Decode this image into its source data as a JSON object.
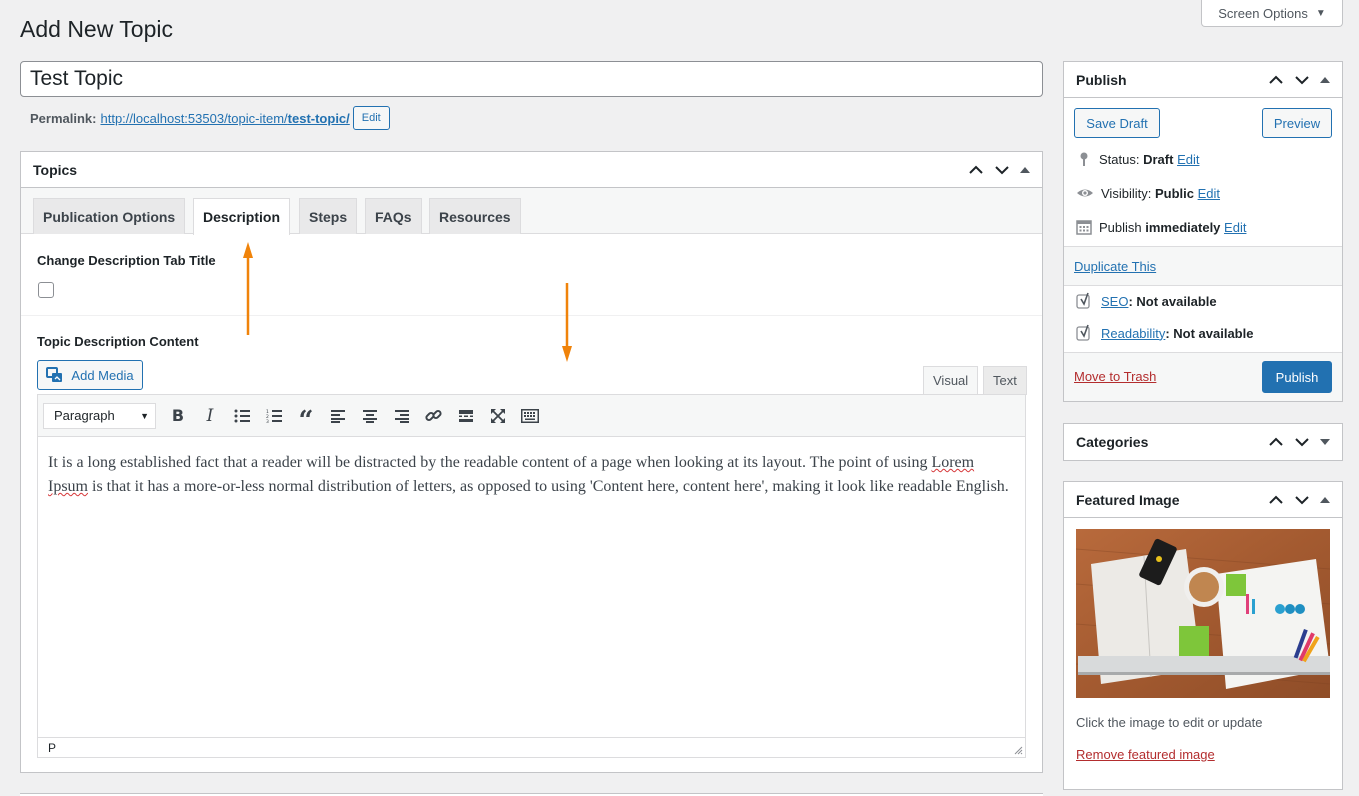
{
  "screen_options": {
    "label": "Screen Options"
  },
  "page": {
    "title": "Add New Topic"
  },
  "post_title": {
    "value": "Test Topic"
  },
  "permalink": {
    "label": "Permalink:",
    "url_base": "http://localhost:53503/topic-item/",
    "slug": "test-topic/",
    "edit_label": "Edit"
  },
  "topics_box": {
    "title": "Topics",
    "tabs": [
      {
        "label": "Publication Options",
        "active": false
      },
      {
        "label": "Description",
        "active": true
      },
      {
        "label": "Steps",
        "active": false
      },
      {
        "label": "FAQs",
        "active": false
      },
      {
        "label": "Resources",
        "active": false
      }
    ],
    "change_tab_title_label": "Change Description Tab Title",
    "description_label": "Topic Description Content",
    "add_media_label": "Add Media",
    "editor_modes": {
      "visual": "Visual",
      "text": "Text",
      "active": "visual"
    },
    "format_select": "Paragraph",
    "toolbar_icons": [
      "bold-icon",
      "italic-icon",
      "bulleted-list-icon",
      "numbered-list-icon",
      "blockquote-icon",
      "align-left-icon",
      "align-center-icon",
      "align-right-icon",
      "link-icon",
      "read-more-icon",
      "fullscreen-icon",
      "toolbar-toggle-icon"
    ],
    "content": {
      "part1": "It is a long established fact that a reader will be distracted by the readable content of a page when looking at its layout. The point of using ",
      "spell_word": "Lorem Ipsum",
      "part2": " is that it has a more-or-less normal distribution of letters, as opposed to using 'Content here, content here', making it look like readable English."
    },
    "statusbar_path": "P"
  },
  "publish_box": {
    "title": "Publish",
    "save_draft": "Save Draft",
    "preview": "Preview",
    "status_label": "Status:",
    "status_value": "Draft",
    "visibility_label": "Visibility:",
    "visibility_value": "Public",
    "publish_label": "Publish",
    "publish_value": "immediately",
    "edit_label": "Edit",
    "duplicate": "Duplicate This",
    "seo_link": "SEO",
    "seo_value": ": Not available",
    "readability_link": "Readability",
    "readability_value": ": Not available",
    "trash": "Move to Trash",
    "publish_button": "Publish"
  },
  "categories_box": {
    "title": "Categories"
  },
  "featured_box": {
    "title": "Featured Image",
    "hint": "Click the image to edit or update",
    "remove": "Remove featured image"
  },
  "colors": {
    "accent": "#2271b1",
    "trash": "#b32d2e",
    "annotation_arrow": "#f0830a"
  }
}
